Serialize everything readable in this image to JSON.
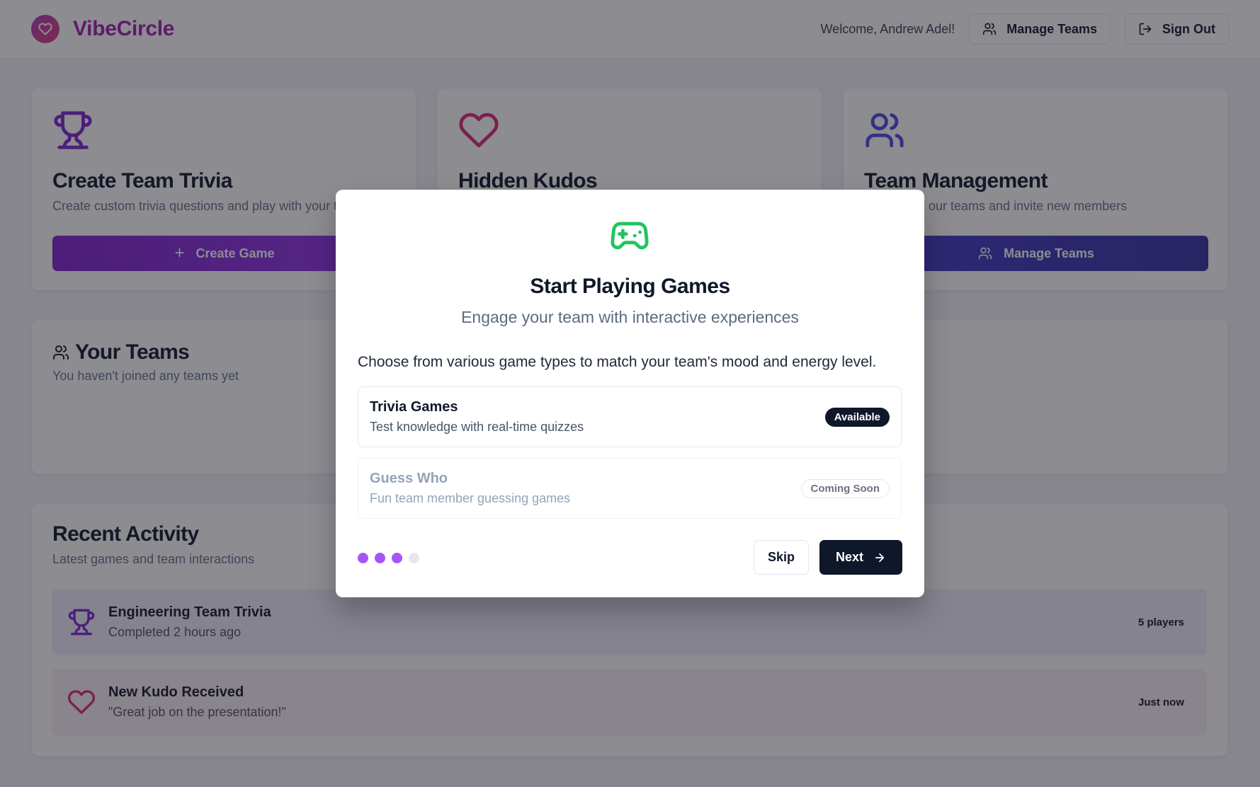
{
  "header": {
    "brand": "VibeCircle",
    "welcome": "Welcome, Andrew Adel!",
    "manage_teams_label": "Manage Teams",
    "sign_out_label": "Sign Out"
  },
  "cards": {
    "trivia": {
      "title": "Create Team Trivia",
      "description": "Create custom trivia questions and play with your t",
      "button": "Create Game"
    },
    "kudos": {
      "title": "Hidden Kudos"
    },
    "management": {
      "title": "Team Management",
      "description": "our teams and invite new members",
      "button": "Manage Teams"
    }
  },
  "teams": {
    "title": "Your Teams",
    "description": "You haven't joined any teams yet"
  },
  "activity": {
    "title": "Recent Activity",
    "description": "Latest games and team interactions",
    "items": [
      {
        "title": "Engineering Team Trivia",
        "subtitle": "Completed 2 hours ago",
        "meta": "5 players",
        "icon": "trophy-icon"
      },
      {
        "title": "New Kudo Received",
        "subtitle": "\"Great job on the presentation!\"",
        "meta": "Just now",
        "icon": "heart-icon"
      }
    ]
  },
  "modal": {
    "icon": "gamepad-icon",
    "title": "Start Playing Games",
    "subtitle": "Engage your team with interactive experiences",
    "text": "Choose from various game types to match your team's mood and energy level.",
    "options": [
      {
        "title": "Trivia Games",
        "subtitle": "Test knowledge with real-time quizzes",
        "badge": "Available"
      },
      {
        "title": "Guess Who",
        "subtitle": "Fun team member guessing games",
        "badge": "Coming Soon"
      }
    ],
    "step": 3,
    "total_steps": 4,
    "skip_label": "Skip",
    "next_label": "Next"
  },
  "colors": {
    "brand": "#a21caf",
    "trivia_button": "#7e22ce",
    "manage_button": "#4338ca",
    "kudos_icon": "#db2777",
    "team_icon": "#4f46e5",
    "game_icon": "#22c55e",
    "dark": "#0f172a"
  }
}
